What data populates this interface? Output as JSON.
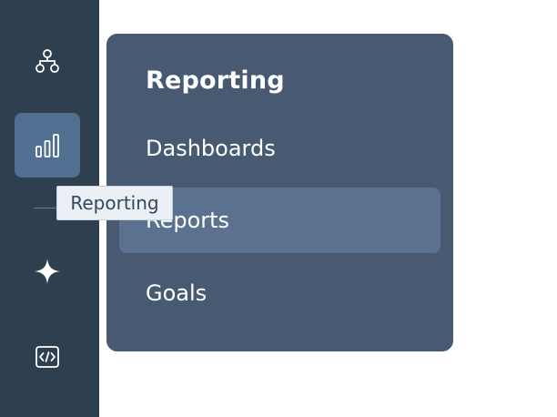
{
  "sidebar": {
    "items": [
      {
        "name": "org-chart-icon"
      },
      {
        "name": "bar-chart-icon",
        "active": true
      },
      {
        "name": "sparkle-icon"
      },
      {
        "name": "code-icon"
      }
    ]
  },
  "flyout": {
    "title": "Reporting",
    "items": [
      {
        "label": "Dashboards"
      },
      {
        "label": "Reports",
        "hovered": true
      },
      {
        "label": "Goals"
      }
    ]
  },
  "tooltip": {
    "text": "Reporting"
  },
  "colors": {
    "rail_bg": "#2e3f50",
    "active_bg": "#516f90",
    "flyout_bg": "#475a72",
    "hover_bg": "#5a7190",
    "tooltip_bg": "#eaf0f6"
  }
}
